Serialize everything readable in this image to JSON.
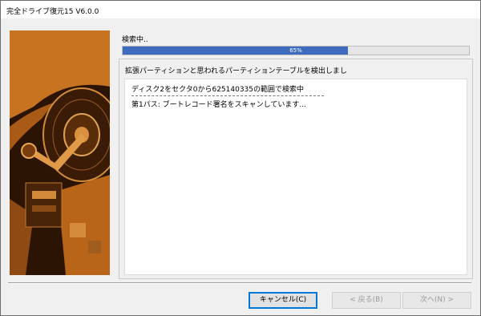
{
  "window": {
    "title": "完全ドライブ復元15 V6.0.0"
  },
  "progress": {
    "status_label": "検索中..",
    "percent": 65,
    "percent_text": "65%",
    "fill_color": "#3e6bbd"
  },
  "group": {
    "title": "拡張パーティションと思われるパーティションテーブルを検出しまし"
  },
  "log": {
    "lines": [
      "ディスク2をセクタ0から625140335の範囲で検索中",
      "第1パス: ブートレコード署名をスキャンしています..."
    ]
  },
  "buttons": {
    "cancel": "キャンセル(C)",
    "back": "< 戻る(B)",
    "next": "次へ(N) >"
  },
  "colors": {
    "image_base": "#2b1404",
    "image_accent": "#c8731f"
  }
}
